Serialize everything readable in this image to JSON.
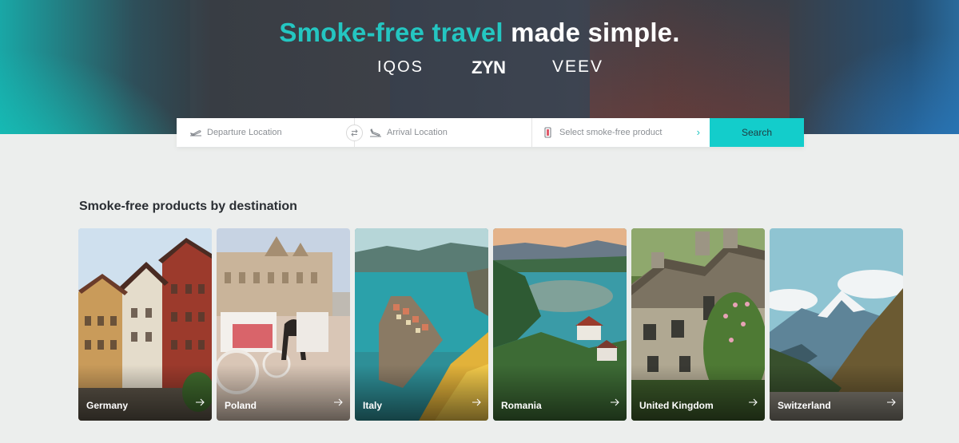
{
  "hero": {
    "headline_accent": "Smoke-free travel",
    "headline_rest": " made simple.",
    "brands": [
      "IQOS",
      "ZYN",
      "VEEV"
    ]
  },
  "search": {
    "departure_placeholder": "Departure Location",
    "arrival_placeholder": "Arrival Location",
    "product_placeholder": "Select smoke-free product",
    "button_label": "Search"
  },
  "destinations": {
    "title": "Smoke-free products by destination",
    "cards": [
      {
        "name": "Germany"
      },
      {
        "name": "Poland"
      },
      {
        "name": "Italy"
      },
      {
        "name": "Romania"
      },
      {
        "name": "United Kingdom"
      },
      {
        "name": "Switzerland"
      }
    ]
  },
  "colors": {
    "accent": "#24c6c1",
    "search_button": "#13cdcb",
    "page_background": "#eceeed"
  },
  "icons": [
    "plane-departure-icon",
    "swap-icon",
    "plane-arrival-icon",
    "product-device-icon",
    "chevron-right-icon",
    "arrow-right-icon"
  ]
}
